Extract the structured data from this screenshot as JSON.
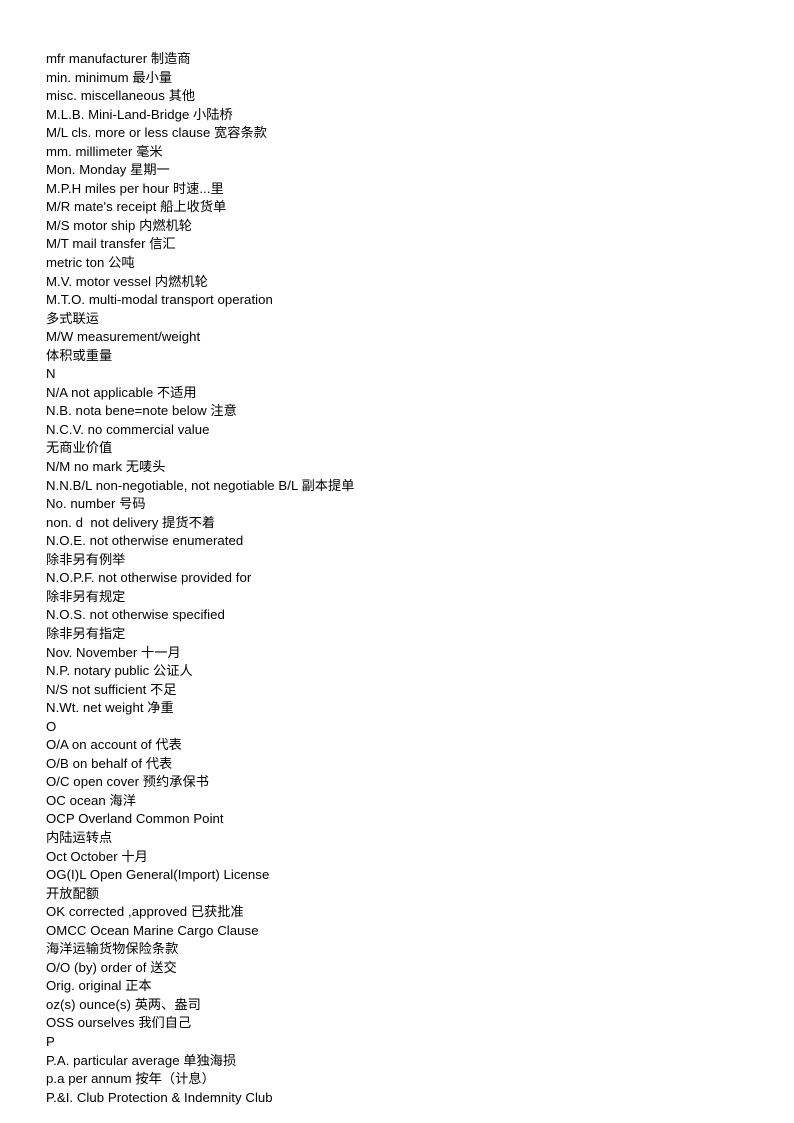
{
  "document": {
    "type": "glossary",
    "title": "Shipping and Trade Abbreviations",
    "language": "en-zh",
    "background_color": "#ffffff",
    "text_color": "#000000"
  },
  "lines": [
    {
      "text": "mfr manufacturer 制造商",
      "kind": "entry"
    },
    {
      "text": "min. minimum 最小量",
      "kind": "entry"
    },
    {
      "text": "misc. miscellaneous 其他",
      "kind": "entry"
    },
    {
      "text": "M.L.B. Mini-Land-Bridge 小陆桥",
      "kind": "entry"
    },
    {
      "text": "M/L cls. more or less clause 宽容条款",
      "kind": "entry"
    },
    {
      "text": "mm. millimeter 毫米",
      "kind": "entry"
    },
    {
      "text": "Mon. Monday 星期一",
      "kind": "entry"
    },
    {
      "text": "M.P.H miles per hour 时速...里",
      "kind": "entry"
    },
    {
      "text": "M/R mate's receipt 船上收货单",
      "kind": "entry"
    },
    {
      "text": "M/S motor ship 内燃机轮",
      "kind": "entry"
    },
    {
      "text": "M/T mail transfer 信汇",
      "kind": "entry"
    },
    {
      "text": "metric ton 公吨",
      "kind": "entry"
    },
    {
      "text": "M.V. motor vessel 内燃机轮",
      "kind": "entry"
    },
    {
      "text": "M.T.O. multi-modal transport operation",
      "kind": "entry"
    },
    {
      "text": "多式联运",
      "kind": "entry-continuation"
    },
    {
      "text": "M/W measurement/weight",
      "kind": "entry"
    },
    {
      "text": "体积或重量",
      "kind": "entry-continuation"
    },
    {
      "text": "N",
      "kind": "section-letter"
    },
    {
      "text": "N/A not applicable 不适用",
      "kind": "entry"
    },
    {
      "text": "N.B. nota bene=note below 注意",
      "kind": "entry"
    },
    {
      "text": "N.C.V. no commercial value",
      "kind": "entry"
    },
    {
      "text": "无商业价值",
      "kind": "entry-continuation"
    },
    {
      "text": "N/M no mark 无唛头",
      "kind": "entry"
    },
    {
      "text": "N.N.B/L non-negotiable, not negotiable B/L 副本提单",
      "kind": "entry"
    },
    {
      "text": "No. number 号码",
      "kind": "entry"
    },
    {
      "text": "non. d  not delivery 提货不着",
      "kind": "entry"
    },
    {
      "text": "N.O.E. not otherwise enumerated",
      "kind": "entry"
    },
    {
      "text": "除非另有例举",
      "kind": "entry-continuation"
    },
    {
      "text": "N.O.P.F. not otherwise provided for",
      "kind": "entry"
    },
    {
      "text": "除非另有规定",
      "kind": "entry-continuation"
    },
    {
      "text": "N.O.S. not otherwise specified",
      "kind": "entry"
    },
    {
      "text": "除非另有指定",
      "kind": "entry-continuation"
    },
    {
      "text": "Nov. November 十一月",
      "kind": "entry"
    },
    {
      "text": "N.P. notary public 公证人",
      "kind": "entry"
    },
    {
      "text": "N/S not sufficient 不足",
      "kind": "entry"
    },
    {
      "text": "N.Wt. net weight 净重",
      "kind": "entry"
    },
    {
      "text": "O",
      "kind": "section-letter"
    },
    {
      "text": "O/A on account of 代表",
      "kind": "entry"
    },
    {
      "text": "O/B on behalf of 代表",
      "kind": "entry"
    },
    {
      "text": "O/C open cover 预约承保书",
      "kind": "entry"
    },
    {
      "text": "OC ocean 海洋",
      "kind": "entry"
    },
    {
      "text": "OCP Overland Common Point",
      "kind": "entry"
    },
    {
      "text": "内陆运转点",
      "kind": "entry-continuation"
    },
    {
      "text": "Oct October 十月",
      "kind": "entry"
    },
    {
      "text": "OG(I)L Open General(Import) License",
      "kind": "entry"
    },
    {
      "text": "开放配额",
      "kind": "entry-continuation"
    },
    {
      "text": "OK corrected ,approved 已获批准",
      "kind": "entry"
    },
    {
      "text": "OMCC Ocean Marine Cargo Clause",
      "kind": "entry"
    },
    {
      "text": "海洋运输货物保险条款",
      "kind": "entry-continuation"
    },
    {
      "text": "O/O (by) order of 送交",
      "kind": "entry"
    },
    {
      "text": "Orig. original 正本",
      "kind": "entry"
    },
    {
      "text": "oz(s) ounce(s) 英两、盎司",
      "kind": "entry"
    },
    {
      "text": "OSS ourselves 我们自己",
      "kind": "entry"
    },
    {
      "text": "P",
      "kind": "section-letter"
    },
    {
      "text": "P.A. particular average 单独海损",
      "kind": "entry"
    },
    {
      "text": "p.a per annum 按年（计息）",
      "kind": "entry"
    },
    {
      "text": "P.&I. Club Protection & Indemnity Club",
      "kind": "entry"
    }
  ]
}
